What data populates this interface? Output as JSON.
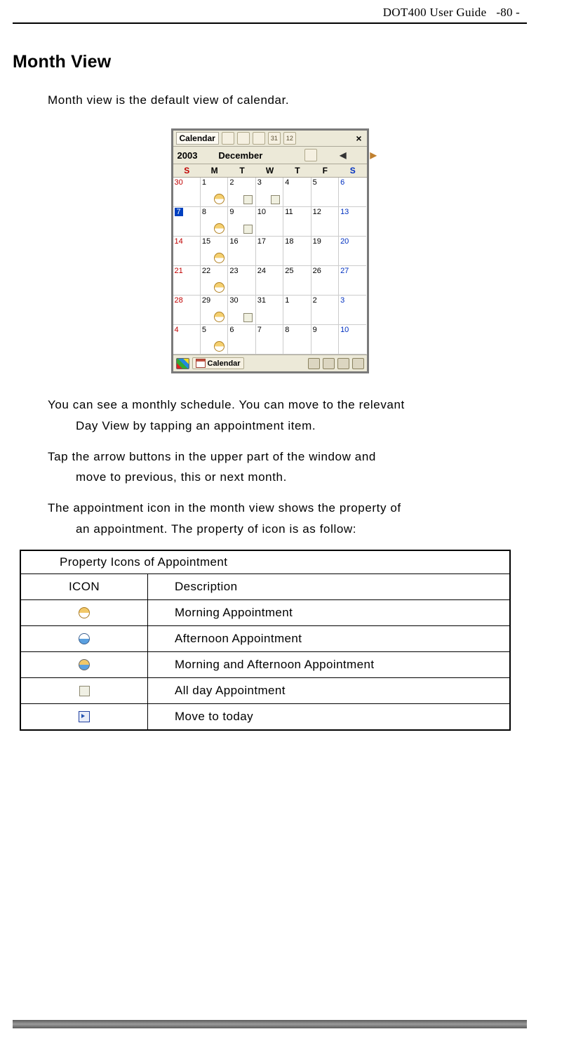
{
  "header": {
    "guide_title": "DOT400 User Guide",
    "page_num": "-80 -"
  },
  "section": {
    "title": "Month View",
    "intro": "Month view is the default view of calendar."
  },
  "app": {
    "tab_label": "Calendar",
    "close_glyph": "×",
    "year": "2003",
    "month": "December",
    "prev_glyph": "◀",
    "next_glyph": "▶",
    "weekdays": [
      "S",
      "M",
      "T",
      "W",
      "T",
      "F",
      "S"
    ],
    "rows": [
      [
        {
          "n": "30",
          "cls": "other-month"
        },
        {
          "n": "1",
          "icon": "morning"
        },
        {
          "n": "2",
          "icon": "allday"
        },
        {
          "n": "3",
          "icon": "allday"
        },
        {
          "n": "4"
        },
        {
          "n": "5"
        },
        {
          "n": "6",
          "cls": "sat"
        }
      ],
      [
        {
          "n": "7",
          "cls": "selected"
        },
        {
          "n": "8",
          "icon": "morning"
        },
        {
          "n": "9",
          "icon": "allday"
        },
        {
          "n": "10"
        },
        {
          "n": "11"
        },
        {
          "n": "12"
        },
        {
          "n": "13",
          "cls": "sat"
        }
      ],
      [
        {
          "n": "14",
          "cls": "weekend"
        },
        {
          "n": "15",
          "icon": "morning"
        },
        {
          "n": "16"
        },
        {
          "n": "17"
        },
        {
          "n": "18"
        },
        {
          "n": "19"
        },
        {
          "n": "20",
          "cls": "sat"
        }
      ],
      [
        {
          "n": "21",
          "cls": "weekend"
        },
        {
          "n": "22",
          "icon": "morning"
        },
        {
          "n": "23"
        },
        {
          "n": "24"
        },
        {
          "n": "25"
        },
        {
          "n": "26"
        },
        {
          "n": "27",
          "cls": "sat"
        }
      ],
      [
        {
          "n": "28",
          "cls": "weekend"
        },
        {
          "n": "29",
          "icon": "morning"
        },
        {
          "n": "30",
          "icon": "allday"
        },
        {
          "n": "31"
        },
        {
          "n": "1"
        },
        {
          "n": "2"
        },
        {
          "n": "3",
          "cls": "sat"
        }
      ],
      [
        {
          "n": "4",
          "cls": "weekend"
        },
        {
          "n": "5",
          "icon": "morning"
        },
        {
          "n": "6"
        },
        {
          "n": "7"
        },
        {
          "n": "8"
        },
        {
          "n": "9"
        },
        {
          "n": "10",
          "cls": "sat"
        }
      ]
    ],
    "status_label": "Calendar"
  },
  "paragraphs": {
    "p1_first": "You can see a monthly schedule. You can move to the relevant",
    "p1_rest": "Day View by tapping an appointment item.",
    "p2_first": "Tap the arrow buttons in the upper part of the window and",
    "p2_rest": "move to previous, this or next month.",
    "p3_first": "The appointment icon in the month view shows the property of",
    "p3_rest": "an appointment. The property of icon is as follow:"
  },
  "table": {
    "caption": "Property Icons of Appointment",
    "head_icon": "ICON",
    "head_desc": "Description",
    "rows": [
      {
        "desc": "Morning Appointment",
        "icon": "morning"
      },
      {
        "desc": "Afternoon Appointment",
        "icon": "afternoon"
      },
      {
        "desc": "Morning and Afternoon Appointment",
        "icon": "both"
      },
      {
        "desc": "All day Appointment",
        "icon": "all"
      },
      {
        "desc": "Move to today",
        "icon": "today"
      }
    ]
  }
}
